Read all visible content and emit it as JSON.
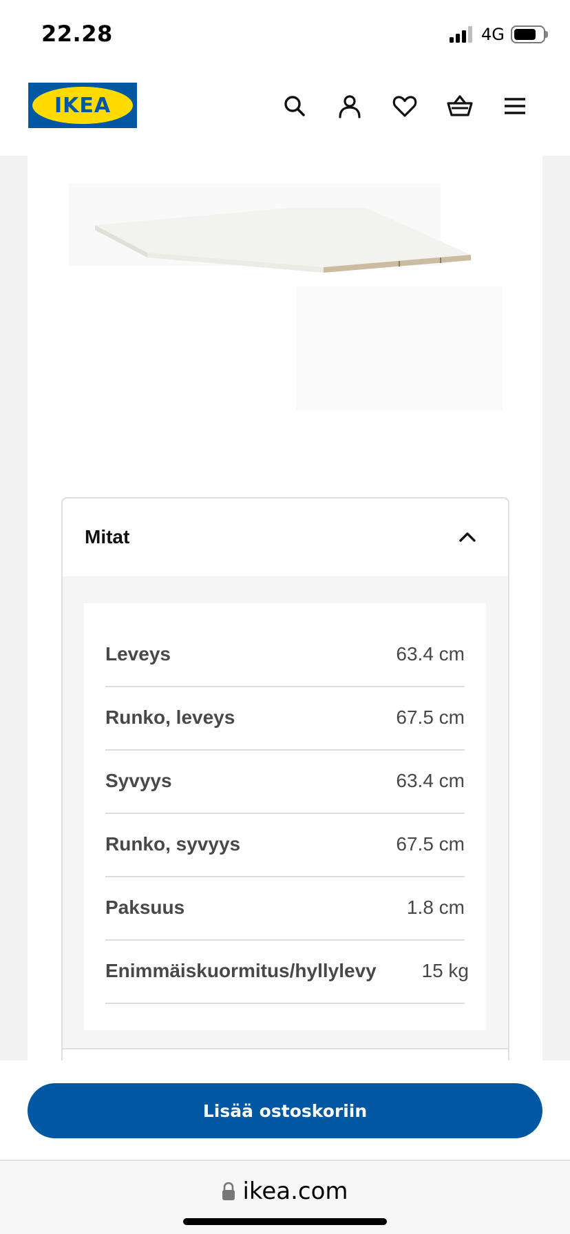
{
  "status_bar": {
    "time": "22.28",
    "network": "4G",
    "battery_level": 0.78
  },
  "header": {
    "logo_text": "IKEA",
    "icons": [
      "search-icon",
      "user-icon",
      "heart-icon",
      "basket-icon",
      "menu-icon"
    ]
  },
  "colors": {
    "brand_blue": "#0058a3",
    "brand_yellow": "#ffdb00"
  },
  "accordion": {
    "title": "Mitat",
    "expanded": true,
    "rows": [
      {
        "label": "Leveys",
        "value": "63.4 cm"
      },
      {
        "label": "Runko, leveys",
        "value": "67.5 cm"
      },
      {
        "label": "Syvyys",
        "value": "63.4 cm"
      },
      {
        "label": "Runko, syvyys",
        "value": "67.5 cm"
      },
      {
        "label": "Paksuus",
        "value": "1.8 cm"
      },
      {
        "label": "Enimmäiskuormitus/hyllylevy",
        "value": "15 kg"
      }
    ]
  },
  "cta": {
    "label": "Lisää ostoskoriin"
  },
  "browser": {
    "url": "ikea.com"
  }
}
